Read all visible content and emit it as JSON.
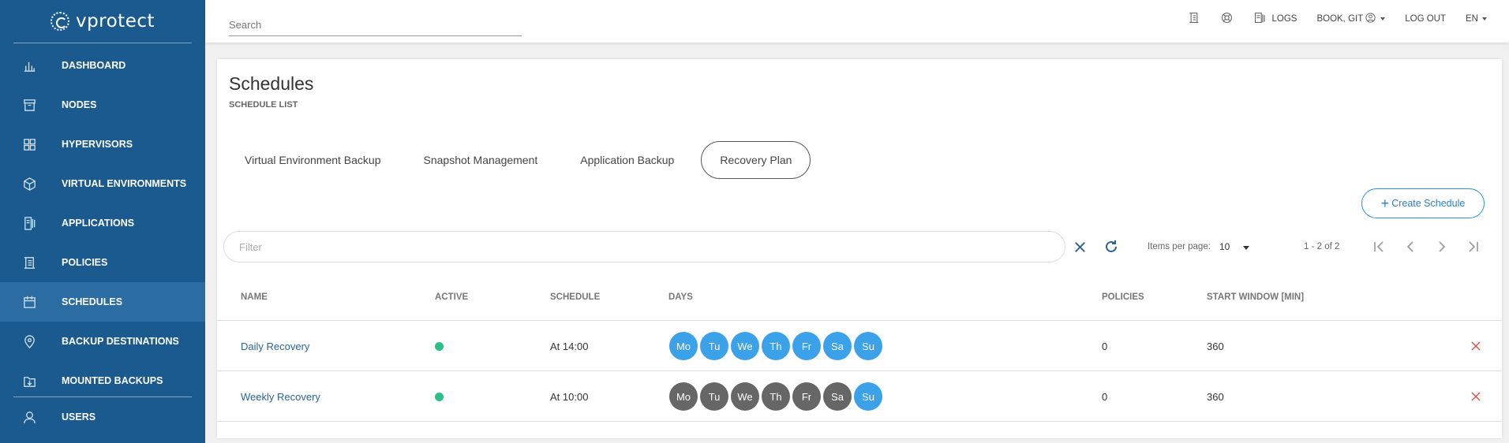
{
  "app": {
    "logo_text": "vprotect"
  },
  "sidebar": {
    "items": [
      {
        "label": "DASHBOARD",
        "icon": "bar-chart-icon",
        "active": false
      },
      {
        "label": "NODES",
        "icon": "server-icon",
        "active": false
      },
      {
        "label": "HYPERVISORS",
        "icon": "grid-icon",
        "active": false
      },
      {
        "label": "VIRTUAL ENVIRONMENTS",
        "icon": "cube-icon",
        "active": false
      },
      {
        "label": "APPLICATIONS",
        "icon": "application-icon",
        "active": false
      },
      {
        "label": "POLICIES",
        "icon": "document-icon",
        "active": false
      },
      {
        "label": "SCHEDULES",
        "icon": "calendar-icon",
        "active": true
      },
      {
        "label": "BACKUP DESTINATIONS",
        "icon": "location-pin-icon",
        "active": false
      },
      {
        "label": "MOUNTED BACKUPS",
        "icon": "folder-download-icon",
        "active": false
      },
      {
        "label": "USERS",
        "icon": "user-icon",
        "active": false
      }
    ]
  },
  "topbar": {
    "search_placeholder": "Search",
    "logs_label": "LOGS",
    "user_label": "BOOK, GIT",
    "logout_label": "LOG OUT",
    "language": "EN"
  },
  "page": {
    "title": "Schedules",
    "subtitle": "SCHEDULE LIST",
    "tabs": [
      {
        "label": "Virtual Environment Backup",
        "active": false
      },
      {
        "label": "Snapshot Management",
        "active": false
      },
      {
        "label": "Application Backup",
        "active": false
      },
      {
        "label": "Recovery Plan",
        "active": true
      }
    ],
    "create_label": "Create Schedule",
    "filter_placeholder": "Filter",
    "items_per_page_label": "Items per page:",
    "items_per_page": "10",
    "range_label": "1 - 2 of 2"
  },
  "table": {
    "headers": {
      "name": "NAME",
      "active": "ACTIVE",
      "schedule": "SCHEDULE",
      "days": "DAYS",
      "policies": "POLICIES",
      "start_window": "START WINDOW [MIN]"
    },
    "rows": [
      {
        "name": "Daily Recovery",
        "active": true,
        "schedule": "At 14:00",
        "days": [
          {
            "label": "Mo",
            "on": true
          },
          {
            "label": "Tu",
            "on": true
          },
          {
            "label": "We",
            "on": true
          },
          {
            "label": "Th",
            "on": true
          },
          {
            "label": "Fr",
            "on": true
          },
          {
            "label": "Sa",
            "on": true
          },
          {
            "label": "Su",
            "on": true
          }
        ],
        "policies": "0",
        "start_window": "360"
      },
      {
        "name": "Weekly Recovery",
        "active": true,
        "schedule": "At 10:00",
        "days": [
          {
            "label": "Mo",
            "on": false
          },
          {
            "label": "Tu",
            "on": false
          },
          {
            "label": "We",
            "on": false
          },
          {
            "label": "Th",
            "on": false
          },
          {
            "label": "Fr",
            "on": false
          },
          {
            "label": "Sa",
            "on": false
          },
          {
            "label": "Su",
            "on": true
          }
        ],
        "policies": "0",
        "start_window": "360"
      }
    ]
  },
  "colors": {
    "sidebar_bg": "#1a5a8f",
    "sidebar_active": "#2b6ca3",
    "accent": "#2b8fd6",
    "day_on": "#3ba1e8",
    "day_off": "#666666",
    "active_dot": "#2bbf8a",
    "delete": "#e05252"
  }
}
